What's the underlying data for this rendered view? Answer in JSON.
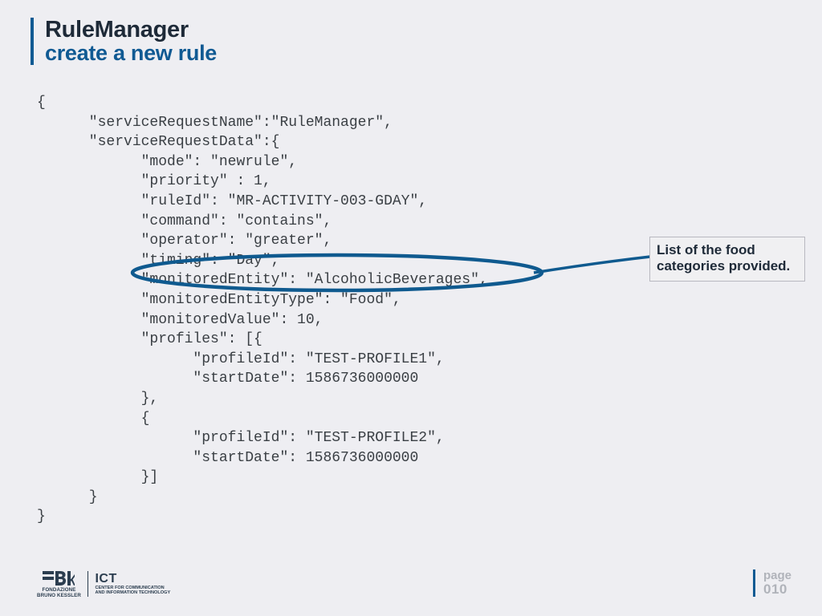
{
  "title": {
    "main": "RuleManager",
    "sub": "create a new rule"
  },
  "code_lines": [
    "{",
    "      \"serviceRequestName\":\"RuleManager\",",
    "      \"serviceRequestData\":{",
    "            \"mode\": \"newrule\",",
    "            \"priority\" : 1,",
    "            \"ruleId\": \"MR-ACTIVITY-003-GDAY\",",
    "            \"command\": \"contains\",",
    "            \"operator\": \"greater\",",
    "            \"timing\": \"Day\",",
    "            \"monitoredEntity\": \"AlcoholicBeverages\",",
    "            \"monitoredEntityType\": \"Food\",",
    "            \"monitoredValue\": 10,",
    "            \"profiles\": [{",
    "                  \"profileId\": \"TEST-PROFILE1\",",
    "                  \"startDate\": 1586736000000",
    "            },",
    "            {",
    "                  \"profileId\": \"TEST-PROFILE2\",",
    "                  \"startDate\": 1586736000000",
    "            }]",
    "      }",
    "}"
  ],
  "annotation": "List of the food categories provided.",
  "footer": {
    "fbk_line1": "FONDAZIONE",
    "fbk_line2": "BRUNO KESSLER",
    "ict_main": "ICT",
    "ict_sub1": "CENTER FOR COMMUNICATION",
    "ict_sub2": "AND INFORMATION TECHNOLOGY",
    "page_label": "page",
    "page_num": "010"
  }
}
